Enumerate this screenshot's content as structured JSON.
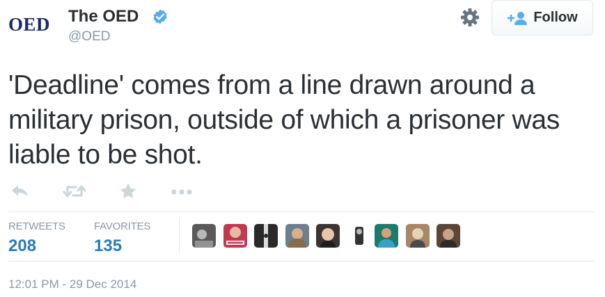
{
  "header": {
    "logo_text": "OED",
    "display_name": "The OED",
    "handle": "@OED",
    "follow_label": "Follow"
  },
  "tweet": {
    "text": "'Deadline' comes from a line drawn around a military prison, outside of which a prisoner was liable to be shot."
  },
  "actions": [
    "reply-icon",
    "retweet-icon",
    "favorite-icon",
    "more-icon"
  ],
  "stats": {
    "retweets_label": "RETWEETS",
    "retweets_count": "208",
    "favorites_label": "FAVORITES",
    "favorites_count": "135"
  },
  "favoriters": [
    {
      "name": "favoriter-avatar-1",
      "bg": "#5a5a5a",
      "fg": "#b8b8b8"
    },
    {
      "name": "favoriter-avatar-2",
      "bg": "#c0394f",
      "fg": "#e8b9a6"
    },
    {
      "name": "favoriter-avatar-3",
      "bg": "#2a2a2a",
      "fg": "#dcdcdc"
    },
    {
      "name": "favoriter-avatar-4",
      "bg": "#6b7f8c",
      "fg": "#d8b08a"
    },
    {
      "name": "favoriter-avatar-5",
      "bg": "#3c3430",
      "fg": "#e9c4a8"
    },
    {
      "name": "favoriter-avatar-6",
      "bg": "#ffffff",
      "fg": "#333333"
    },
    {
      "name": "favoriter-avatar-7",
      "bg": "#1f7a6e",
      "fg": "#3aa0c8"
    },
    {
      "name": "favoriter-avatar-8",
      "bg": "#a88766",
      "fg": "#e6d2b5"
    },
    {
      "name": "favoriter-avatar-9",
      "bg": "#5c4638",
      "fg": "#c9a28a"
    }
  ],
  "timestamp": "12:01 PM - 29 Dec 2014",
  "colors": {
    "text": "#292f33",
    "muted": "#8899a6",
    "link_blue": "#2b7bb9",
    "verified_blue": "#55acee",
    "icon_gray": "#ccd6dd",
    "logo_navy": "#1b2a66"
  }
}
